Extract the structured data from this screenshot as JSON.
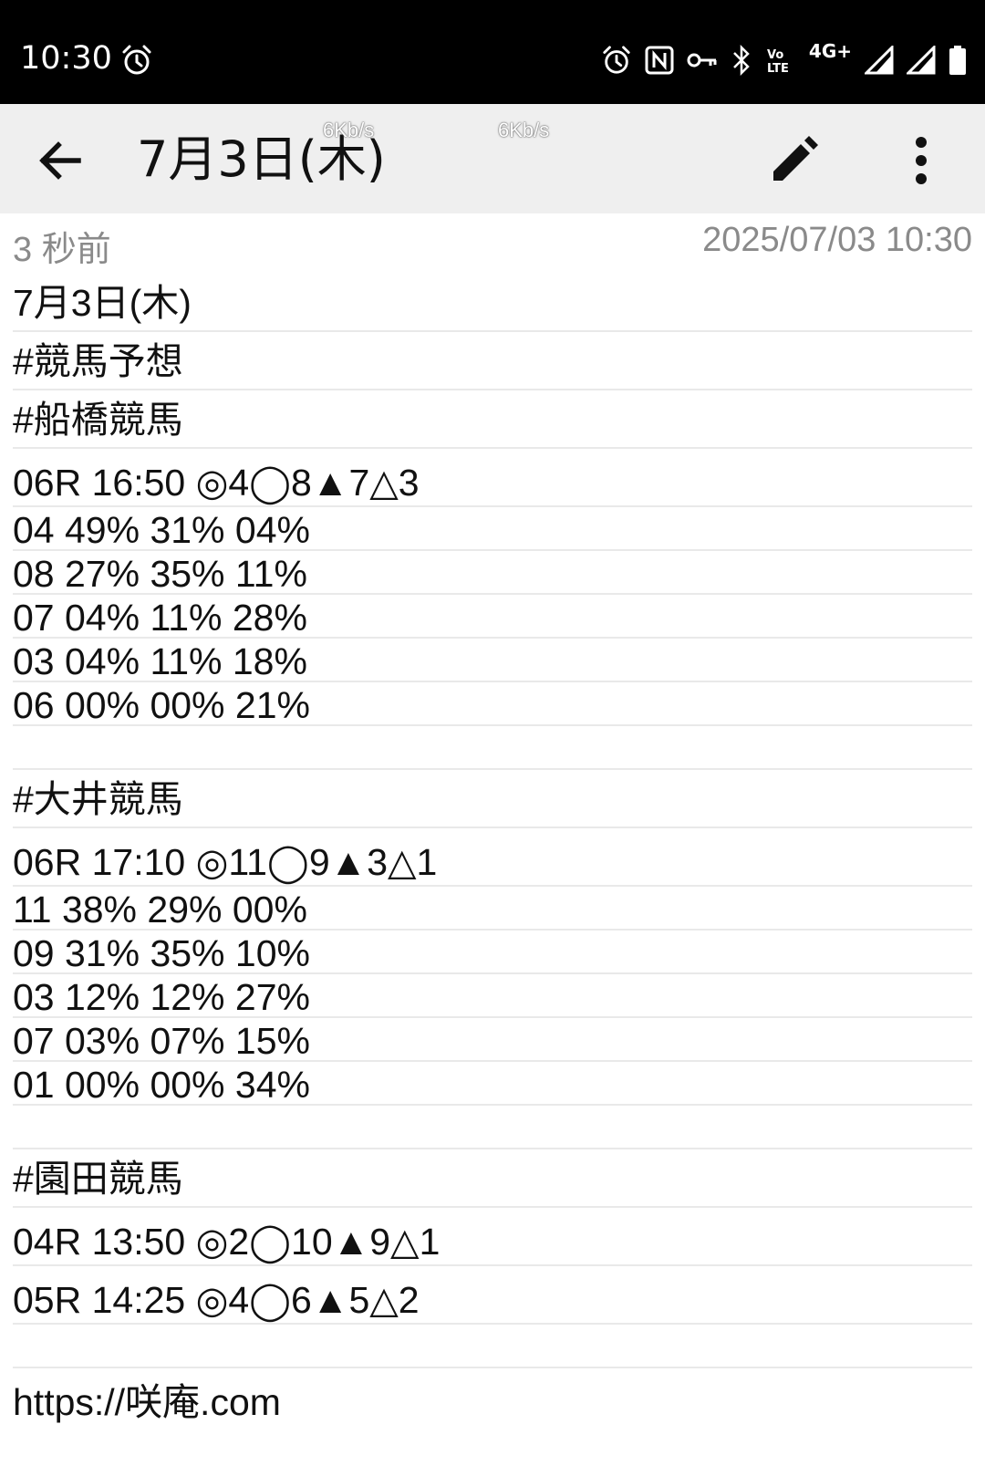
{
  "status_bar": {
    "time": "10:30",
    "network_label": "4G+",
    "icons": [
      "alarm-icon",
      "nfc-icon",
      "vpn-key-icon",
      "bluetooth-icon",
      "volte-icon",
      "signal-icon",
      "battery-icon"
    ]
  },
  "app_bar": {
    "title": "7月3日(木)",
    "speed_1": "6Kb/s",
    "speed_2": "6Kb/s",
    "icons": [
      "back-arrow-icon",
      "edit-pencil-icon",
      "more-vert-icon"
    ]
  },
  "meta": {
    "relative_time": "3 秒前",
    "timestamp": "2025/07/03 10:30"
  },
  "note": {
    "lines": [
      "7月3日(木)",
      "#競馬予想",
      "#船橋競馬",
      "06R 16:50 ◎4◯8▲7△3",
      "04 49% 31% 04%",
      "08 27% 35% 11%",
      "07 04% 11% 28%",
      "03 04% 11% 18%",
      "06 00% 00% 21%",
      "",
      "#大井競馬",
      "06R 17:10 ◎11◯9▲3△1",
      "11 38% 29% 00%",
      "09 31% 35% 10%",
      "03 12% 12% 27%",
      "07 03% 07% 15%",
      "01 00% 00% 34%",
      "",
      "#園田競馬",
      "04R 13:50 ◎2◯10▲9△1",
      "05R 14:25 ◎4◯6▲5△2",
      "",
      "https://咲庵.com"
    ]
  },
  "colors": {
    "status_bar_bg": "#000000",
    "app_bar_bg": "#efefef",
    "meta_text": "#8a8a8a",
    "rule_line": "#e9e9e9"
  }
}
